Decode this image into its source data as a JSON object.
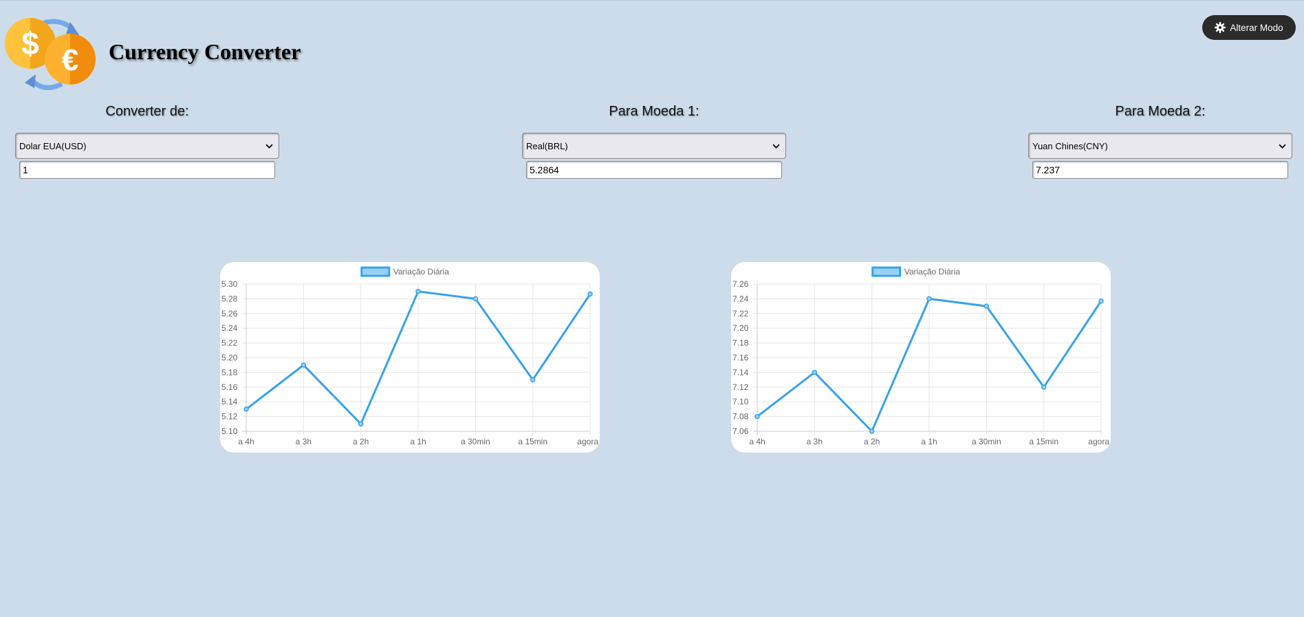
{
  "header": {
    "title": "Currency Converter",
    "mode_button_label": "Alterar Modo",
    "mode_icon": "gear-icon",
    "logo_icon": "currency-exchange-icon"
  },
  "converter": {
    "from": {
      "heading": "Converter de:",
      "selected": "Dolar EUA(USD)",
      "amount": "1"
    },
    "to1": {
      "heading": "Para Moeda 1:",
      "selected": "Real(BRL)",
      "amount": "5.2864"
    },
    "to2": {
      "heading": "Para Moeda 2:",
      "selected": "Yuan Chines(CNY)",
      "amount": "7.237"
    }
  },
  "colors": {
    "background": "#cddcea",
    "line": "#36a2eb",
    "legend_fill": "#9ad0f5",
    "button": "#2b2b2b"
  },
  "chart_data": [
    {
      "type": "line",
      "legend": "Variação Diária",
      "categories": [
        "a 4h",
        "a 3h",
        "a 2h",
        "a 1h",
        "a 30min",
        "a 15min",
        "agora"
      ],
      "series": [
        {
          "name": "Variação Diária",
          "values": [
            5.13,
            5.19,
            5.11,
            5.29,
            5.28,
            5.17,
            5.2864
          ]
        }
      ],
      "ylim": [
        5.1,
        5.3
      ],
      "yticks": [
        "5.30",
        "5.28",
        "5.26",
        "5.24",
        "5.22",
        "5.20",
        "5.18",
        "5.16",
        "5.14",
        "5.12",
        "5.10"
      ],
      "grid": true,
      "legend_position": "top"
    },
    {
      "type": "line",
      "legend": "Variação Diária",
      "categories": [
        "a 4h",
        "a 3h",
        "a 2h",
        "a 1h",
        "a 30min",
        "a 15min",
        "agora"
      ],
      "series": [
        {
          "name": "Variação Diária",
          "values": [
            7.08,
            7.14,
            7.06,
            7.24,
            7.23,
            7.12,
            7.237
          ]
        }
      ],
      "ylim": [
        7.06,
        7.26
      ],
      "yticks": [
        "7.26",
        "7.24",
        "7.22",
        "7.20",
        "7.18",
        "7.16",
        "7.14",
        "7.12",
        "7.10",
        "7.08",
        "7.06"
      ],
      "grid": true,
      "legend_position": "top"
    }
  ]
}
